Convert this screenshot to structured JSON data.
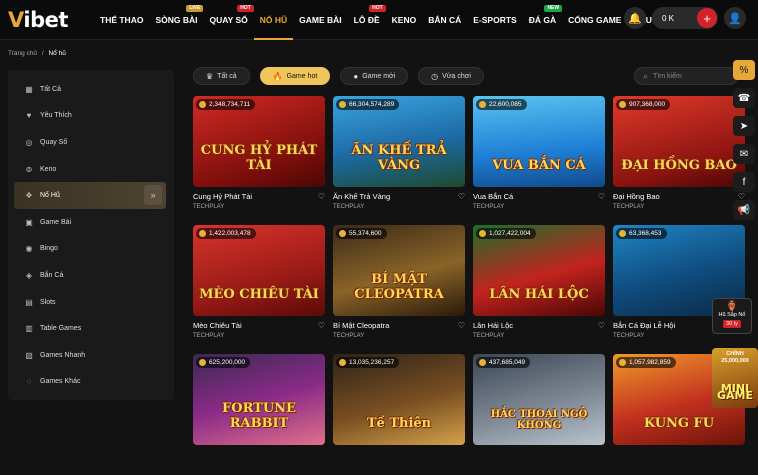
{
  "logo": {
    "prefix": "V",
    "rest": "ibet"
  },
  "nav": [
    {
      "label": "THỂ THAO",
      "badge": ""
    },
    {
      "label": "SÒNG BÀI",
      "badge": "LIVE",
      "badge_type": "live"
    },
    {
      "label": "QUAY SỐ",
      "badge": "HOT",
      "badge_type": "hot"
    },
    {
      "label": "NỔ HŨ",
      "badge": ""
    },
    {
      "label": "GAME BÀI",
      "badge": ""
    },
    {
      "label": "LÔ ĐỀ",
      "badge": "HOT",
      "badge_type": "hot"
    },
    {
      "label": "KENO",
      "badge": ""
    },
    {
      "label": "BẮN CÁ",
      "badge": ""
    },
    {
      "label": "E-SPORTS",
      "badge": ""
    },
    {
      "label": "ĐÁ GÀ",
      "badge": "NEW",
      "badge_type": "new"
    },
    {
      "label": "CỔNG GAME",
      "badge": ""
    },
    {
      "label": "KHUYẾN MÃI",
      "badge": ""
    }
  ],
  "topbar": {
    "balance": "0 K",
    "plus": "+",
    "bell_icon": "bell-icon",
    "user_icon": "user-icon"
  },
  "breadcrumb": {
    "home": "Trang chủ",
    "separator": "/",
    "current": "Nổ hũ"
  },
  "sidebar": [
    {
      "label": "Tất Cả",
      "icon": "grid-icon",
      "glyph": "▦"
    },
    {
      "label": "Yêu Thích",
      "icon": "heart-icon",
      "glyph": "♥"
    },
    {
      "label": "Quay Số",
      "icon": "lottery-icon",
      "glyph": "◎"
    },
    {
      "label": "Keno",
      "icon": "keno-icon",
      "glyph": "⊚"
    },
    {
      "label": "Nổ Hũ",
      "icon": "jar-icon",
      "glyph": "❖"
    },
    {
      "label": "Game Bài",
      "icon": "cards-icon",
      "glyph": "▣"
    },
    {
      "label": "Bingo",
      "icon": "bingo-icon",
      "glyph": "◉"
    },
    {
      "label": "Bắn Cá",
      "icon": "fish-icon",
      "glyph": "◈"
    },
    {
      "label": "Slots",
      "icon": "slots-icon",
      "glyph": "▤"
    },
    {
      "label": "Table Games",
      "icon": "table-icon",
      "glyph": "▥"
    },
    {
      "label": "Games Nhanh",
      "icon": "fast-games-icon",
      "glyph": "▧"
    },
    {
      "label": "Games Khác",
      "icon": "other-games-icon",
      "glyph": "◌"
    }
  ],
  "filters": [
    {
      "label": "Tất cả",
      "icon": "crown-icon",
      "glyph": "♛"
    },
    {
      "label": "Game hot",
      "icon": "fire-icon",
      "glyph": "🔥"
    },
    {
      "label": "Game mới",
      "icon": "new-icon",
      "glyph": "●"
    },
    {
      "label": "Vừa chơi",
      "icon": "clock-icon",
      "glyph": "◷"
    }
  ],
  "search": {
    "placeholder": "Tìm kiếm",
    "icon": "search-icon"
  },
  "games": [
    {
      "name": "Cung Hỷ Phát Tài",
      "provider": "TECHPLAY",
      "jackpot": "2,348,734,711",
      "art": "CUNG HỶ PHÁT TÀI"
    },
    {
      "name": "Ăn Khế Trả Vàng",
      "provider": "TECHPLAY",
      "jackpot": "66,304,574,289",
      "art": "ĂN KHẾ TRẢ VÀNG"
    },
    {
      "name": "Vua Bắn Cá",
      "provider": "TECHPLAY",
      "jackpot": "22,600,085",
      "art": "VUA BẮN CÁ"
    },
    {
      "name": "Đại Hồng Bao",
      "provider": "TECHPLAY",
      "jackpot": "907,368,000",
      "art": "ĐẠI HỒNG BAO"
    },
    {
      "name": "Mèo Chiêu Tài",
      "provider": "TECHPLAY",
      "jackpot": "1,422,003,478",
      "art": "MÈO CHIÊU TÀI"
    },
    {
      "name": "Bí Mật Cleopatra",
      "provider": "TECHPLAY",
      "jackpot": "55,374,600",
      "art": "BÍ MẬT CLEOPATRA"
    },
    {
      "name": "Lân Hái Lộc",
      "provider": "TECHPLAY",
      "jackpot": "1,027,422,004",
      "art": "LÂN HÁI LỘC"
    },
    {
      "name": "Bắn Cá Đại Lễ Hội",
      "provider": "TECHPLAY",
      "jackpot": "63,368,453",
      "art": ""
    },
    {
      "name": "",
      "provider": "",
      "jackpot": "625,200,000",
      "art": "FORTUNE RABBIT"
    },
    {
      "name": "",
      "provider": "",
      "jackpot": "13,035,236,257",
      "art": "Tề Thiên"
    },
    {
      "name": "",
      "provider": "",
      "jackpot": "437,685,049",
      "art": "HẮC THOẠI NGỘ KHÔNG"
    },
    {
      "name": "",
      "provider": "",
      "jackpot": "1,057,982,859",
      "art": "KUNG FU"
    }
  ],
  "float_badge": {
    "line1": "Hũ Sắp Nổ",
    "line2": "30 ty"
  },
  "mini_game": {
    "top": "CHÍNH",
    "amount": "25,000,000",
    "label": "MINI GAME"
  },
  "right_rail": [
    "promo-icon",
    "phone-icon",
    "telegram-icon",
    "messenger-icon",
    "facebook-icon",
    "megaphone-icon"
  ]
}
